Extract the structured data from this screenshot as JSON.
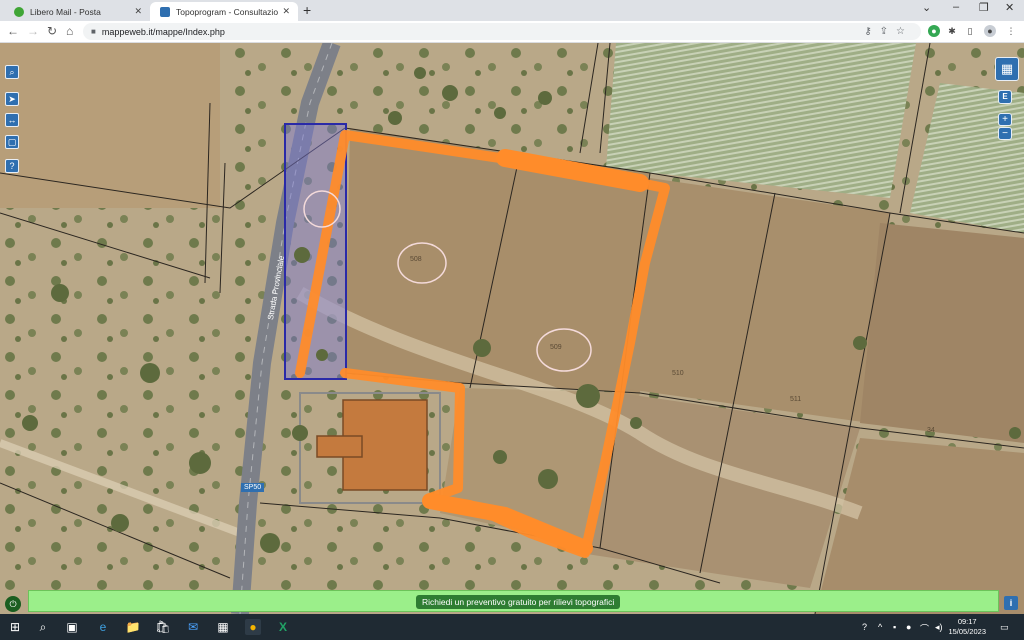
{
  "tabs": [
    {
      "title": "Libero Mail - Posta",
      "close": "✕",
      "favicon_color": "#3fa535"
    },
    {
      "title": "Topoprogram - Consultazione m",
      "close": "✕",
      "favicon_color": "#2f6fb0"
    }
  ],
  "new_tab": "+",
  "window_controls": {
    "minimize": "⌄",
    "min": "–",
    "restore": "❐",
    "close": "✕"
  },
  "toolbar": {
    "back": "←",
    "forward": "→",
    "reload": "↻",
    "home": "⌂",
    "url": "mappeweb.it/mappe/Index.php",
    "lock": "🔒"
  },
  "map": {
    "road_label": "Strada Provinciale",
    "road_code": "SP50",
    "parcels": [
      "508",
      "509",
      "510",
      "511",
      "34"
    ],
    "left_tools": [
      "search-icon",
      "locate-icon",
      "measure-icon",
      "select-icon",
      "help-icon"
    ],
    "left_tool_glyphs": [
      "⌕",
      "➤",
      "↔",
      "▢",
      "?"
    ],
    "right_tools": {
      "layers": "▦",
      "e": "E",
      "zoom_in": "+",
      "zoom_out": "−"
    }
  },
  "banner": {
    "button": "Richiedi un preventivo gratuito per rilievi topografici",
    "power": "⏻",
    "info": "i"
  },
  "taskbar": {
    "time": "09:17",
    "date": "15/05/2023",
    "icons": [
      "⊞",
      "⌕",
      "▣",
      "e",
      "📁",
      "🛍",
      "✉",
      "▦",
      "●",
      "X"
    ]
  },
  "colors": {
    "orange": "#ff8c2a",
    "blue_box": "#2a2aa8",
    "banner": "#9bef8a"
  }
}
